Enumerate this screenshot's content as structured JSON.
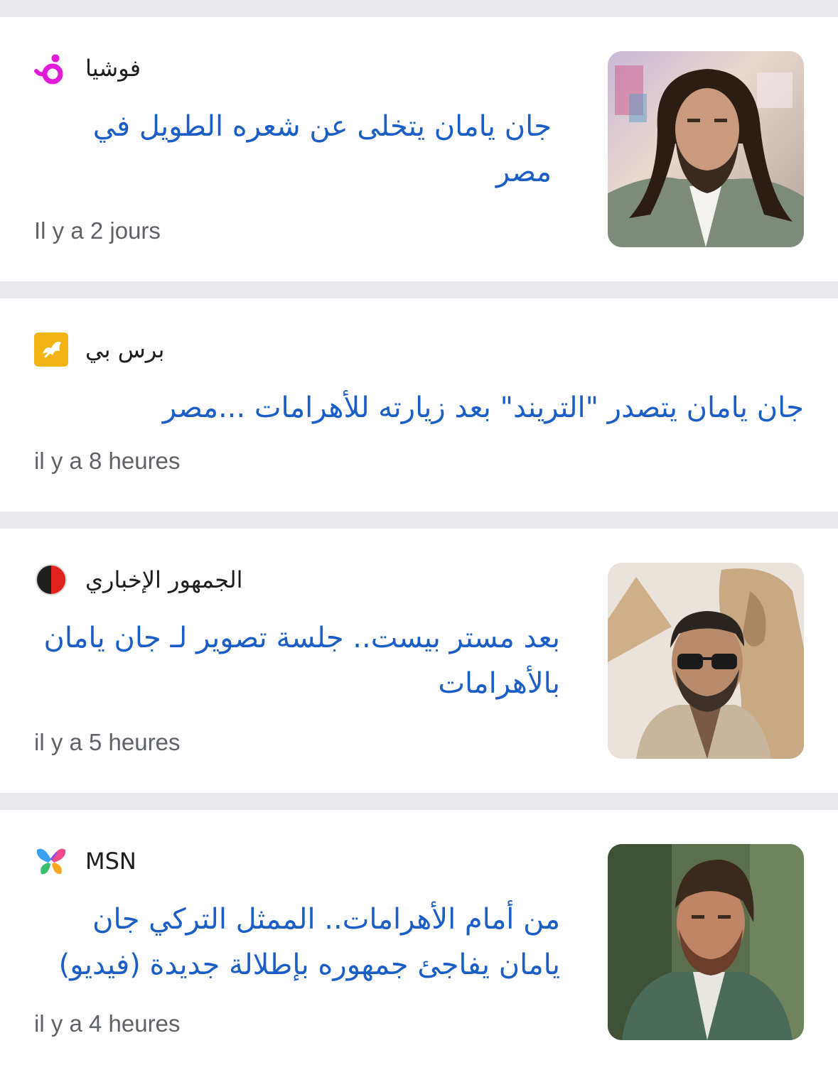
{
  "articles": [
    {
      "source": "فوشيا",
      "source_logo": "fuchsia-logo-icon",
      "headline": "جان يامان يتخلى عن شعره الطويل في مصر",
      "time": "Il y a 2 jours",
      "thumbnail": "man-long-hair-photo"
    },
    {
      "source": "برس بي",
      "source_logo": "press-bee-logo-icon",
      "headline": "جان يامان يتصدر \"التريند\" بعد زيارته للأهرامات ...مصر",
      "time": "il y a 8 heures"
    },
    {
      "source": "الجمهور الإخباري",
      "source_logo": "aljumhour-logo-icon",
      "headline": "بعد مستر بيست.. جلسة تصوير لـ جان يامان بالأهرامات",
      "time": "il y a 5 heures",
      "thumbnail": "man-sunglasses-sphinx-photo"
    },
    {
      "source": "MSN",
      "source_logo": "msn-butterfly-logo-icon",
      "headline": "من أمام الأهرامات.. الممثل التركي جان يامان يفاجئ جمهوره بإطلالة جديدة (فيديو)",
      "time": "il y a 4 heures",
      "thumbnail": "man-green-jacket-photo"
    }
  ]
}
